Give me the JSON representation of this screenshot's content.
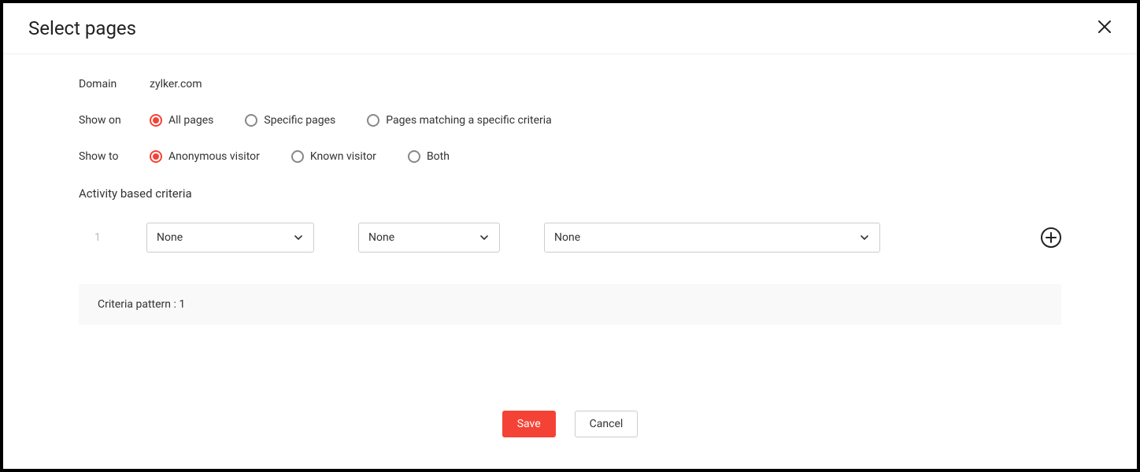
{
  "header": {
    "title": "Select pages"
  },
  "domain": {
    "label": "Domain",
    "value": "zylker.com"
  },
  "show_on": {
    "label": "Show on",
    "options": [
      {
        "label": "All pages",
        "checked": true
      },
      {
        "label": "Specific pages",
        "checked": false
      },
      {
        "label": "Pages matching a specific criteria",
        "checked": false
      }
    ]
  },
  "show_to": {
    "label": "Show to",
    "options": [
      {
        "label": "Anonymous visitor",
        "checked": true
      },
      {
        "label": "Known visitor",
        "checked": false
      },
      {
        "label": "Both",
        "checked": false
      }
    ]
  },
  "activity": {
    "heading": "Activity based criteria",
    "rows": [
      {
        "index": "1",
        "col1": "None",
        "col2": "None",
        "col3": "None"
      }
    ]
  },
  "pattern": {
    "text": "Criteria pattern : 1"
  },
  "footer": {
    "save": "Save",
    "cancel": "Cancel"
  }
}
